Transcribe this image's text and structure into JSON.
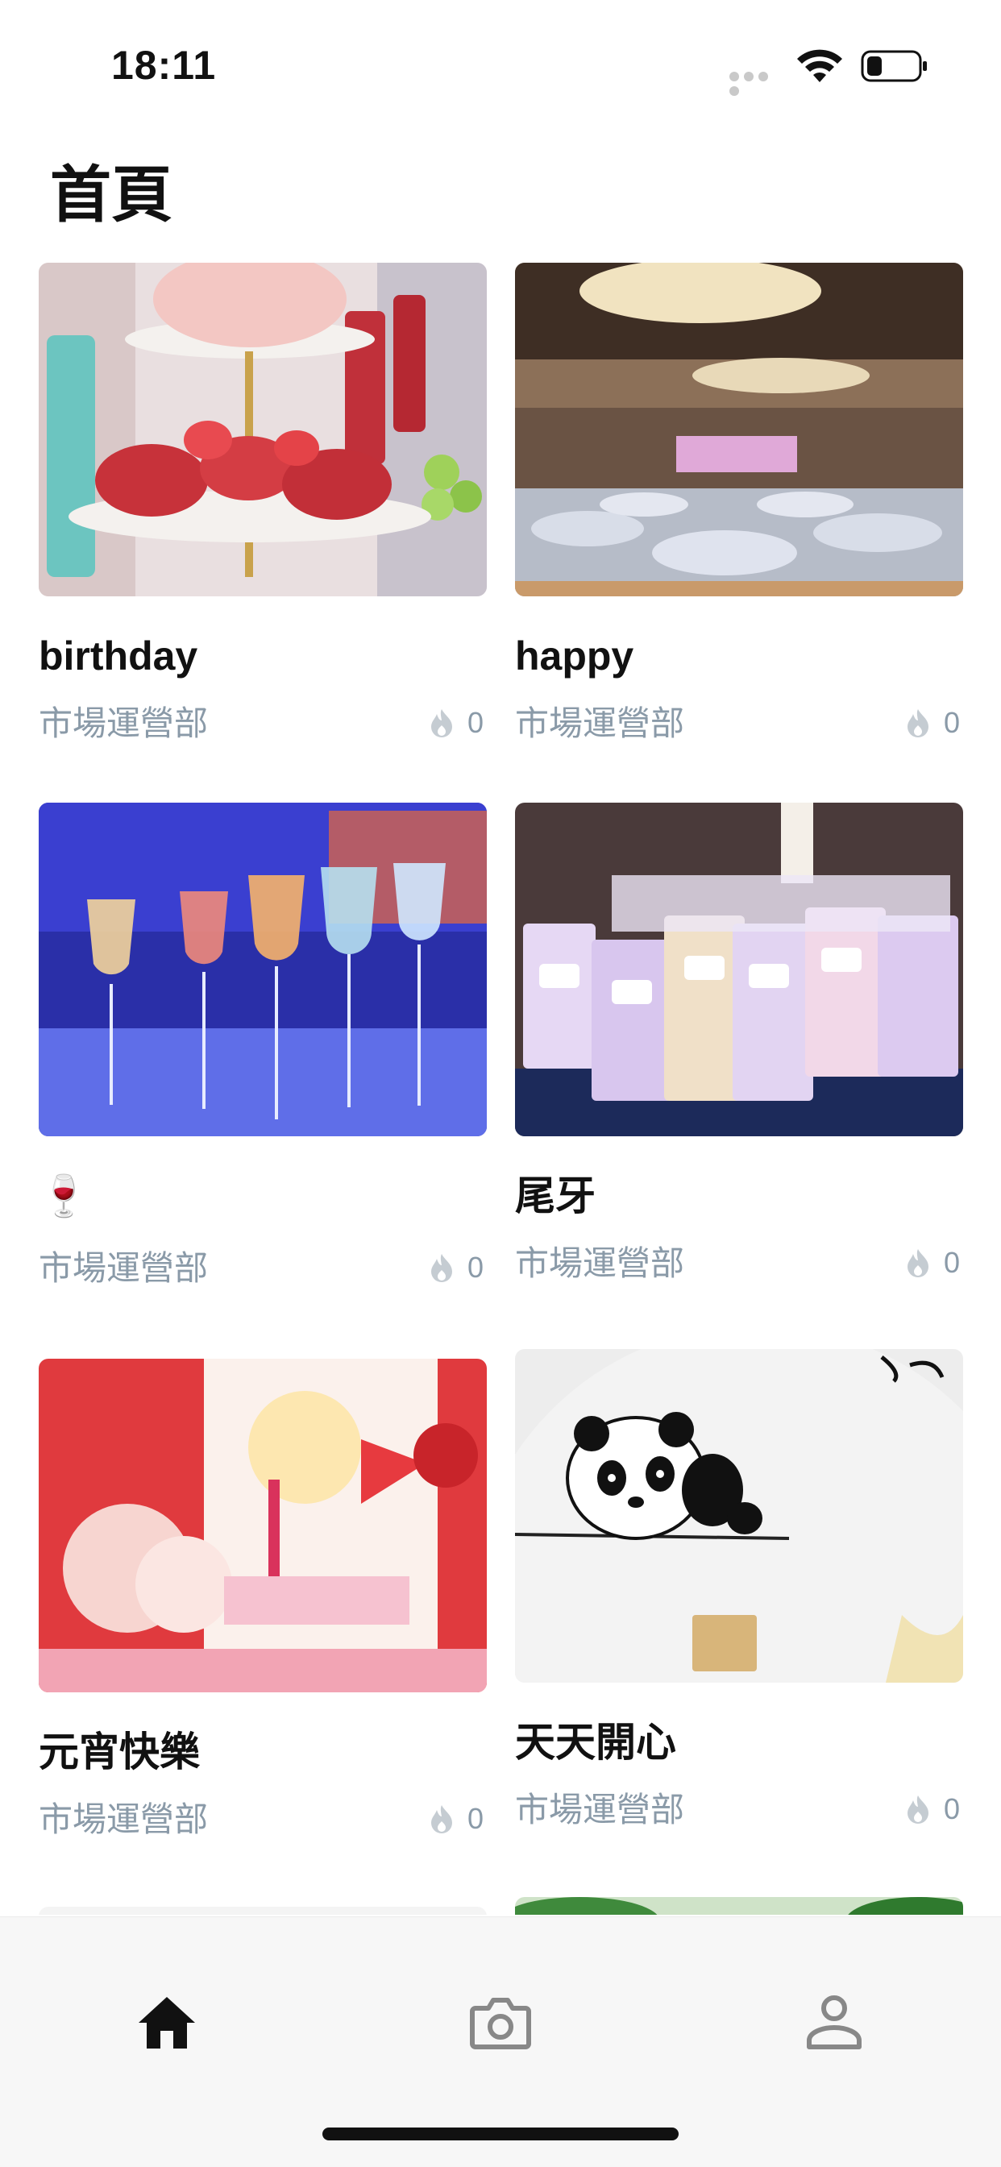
{
  "status_bar": {
    "time": "18:11"
  },
  "header": {
    "title": "首頁"
  },
  "cards": [
    {
      "title": "birthday",
      "department": "市場運營部",
      "likes": "0",
      "image": "dessert-tower"
    },
    {
      "title": "happy",
      "department": "市場運營部",
      "likes": "0",
      "image": "banquet-hall"
    },
    {
      "title": "🍷",
      "department": "市場運營部",
      "likes": "0",
      "image": "cocktail-glasses"
    },
    {
      "title": "尾牙",
      "department": "市場運營部",
      "likes": "0",
      "image": "gift-bags"
    },
    {
      "title": "元宵快樂",
      "department": "市場運營部",
      "likes": "0",
      "image": "lantern-festival"
    },
    {
      "title": "天天開心",
      "department": "市場運營部",
      "likes": "0",
      "image": "panda-fan"
    }
  ],
  "tab_bar": {
    "items": [
      "home-icon",
      "camera-icon",
      "profile-icon"
    ],
    "active": "home-icon"
  },
  "colors": {
    "meta_text": "#8a9aa8",
    "tab_bar_bg": "#f7f7f7",
    "active_tab": "#111111",
    "inactive_tab": "#888888"
  }
}
